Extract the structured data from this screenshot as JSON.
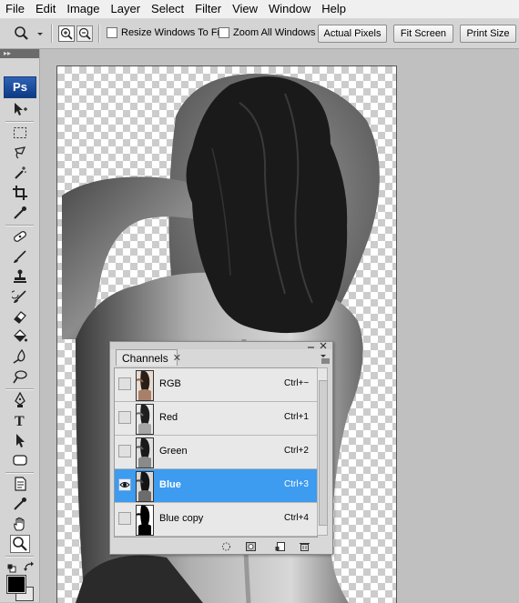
{
  "menubar": {
    "items": [
      "File",
      "Edit",
      "Image",
      "Layer",
      "Select",
      "Filter",
      "View",
      "Window",
      "Help"
    ]
  },
  "options": {
    "resize_windows": "Resize Windows To Fit",
    "zoom_all": "Zoom All Windows",
    "actual_pixels": "Actual Pixels",
    "fit_screen": "Fit Screen",
    "print_size": "Print Size"
  },
  "toolbox": {
    "logo": "Ps",
    "header": "▸▸"
  },
  "channels": {
    "tab_label": "Channels",
    "rows": [
      {
        "name": "RGB",
        "shortcut": "Ctrl+~",
        "selected": false,
        "visible": false
      },
      {
        "name": "Red",
        "shortcut": "Ctrl+1",
        "selected": false,
        "visible": false
      },
      {
        "name": "Green",
        "shortcut": "Ctrl+2",
        "selected": false,
        "visible": false
      },
      {
        "name": "Blue",
        "shortcut": "Ctrl+3",
        "selected": true,
        "visible": true
      },
      {
        "name": "Blue copy",
        "shortcut": "Ctrl+4",
        "selected": false,
        "visible": false
      }
    ]
  },
  "colors": {
    "selection": "#3d9bf0",
    "foreground": "#000000",
    "background": "#ffffff"
  }
}
